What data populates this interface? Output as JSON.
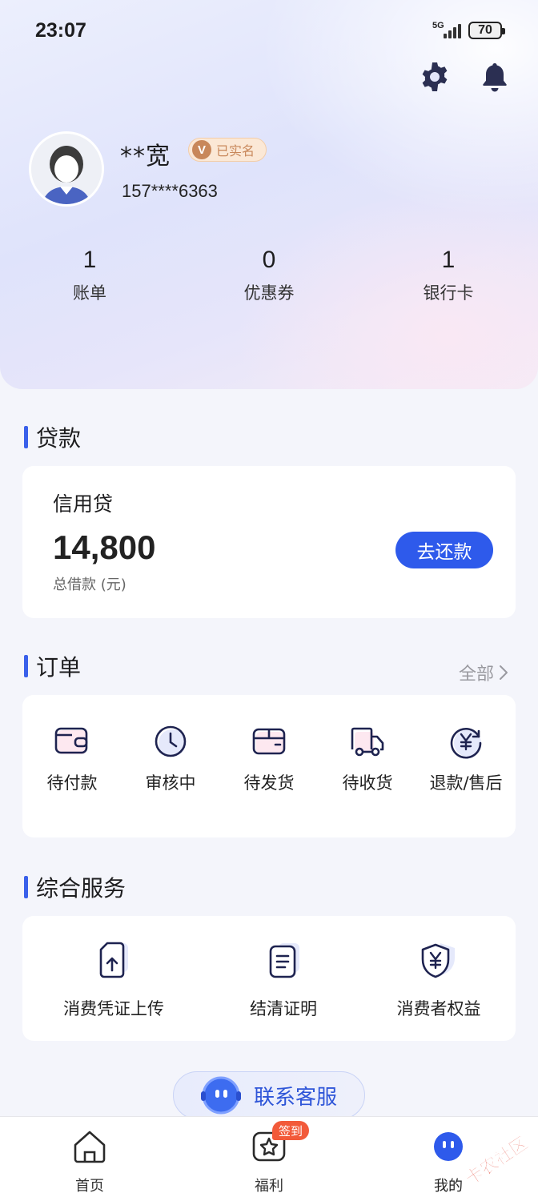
{
  "status_bar": {
    "time": "23:07",
    "network": "5G",
    "battery": "70"
  },
  "profile": {
    "name": "**宽",
    "verified_label": "已实名",
    "verified_badge": "V",
    "phone": "157****6363"
  },
  "stats": [
    {
      "value": "1",
      "label": "账单"
    },
    {
      "value": "0",
      "label": "优惠券"
    },
    {
      "value": "1",
      "label": "银行卡"
    }
  ],
  "loan": {
    "section_title": "贷款",
    "type": "信用贷",
    "amount": "14,800",
    "caption": "总借款 (元)",
    "repay_label": "去还款"
  },
  "orders": {
    "section_title": "订单",
    "see_all": "全部",
    "items": [
      {
        "label": "待付款",
        "icon": "wallet-icon"
      },
      {
        "label": "审核中",
        "icon": "clock-icon"
      },
      {
        "label": "待发货",
        "icon": "package-icon"
      },
      {
        "label": "待收货",
        "icon": "truck-icon"
      },
      {
        "label": "退款/售后",
        "icon": "yuan-refund-icon"
      }
    ]
  },
  "services": {
    "section_title": "综合服务",
    "items": [
      {
        "label": "消费凭证上传",
        "icon": "upload-document-icon"
      },
      {
        "label": "结清证明",
        "icon": "certificate-icon"
      },
      {
        "label": "消费者权益",
        "icon": "shield-yuan-icon"
      }
    ]
  },
  "customer_service": {
    "label": "联系客服"
  },
  "tabbar": {
    "items": [
      {
        "label": "首页",
        "icon": "home-icon"
      },
      {
        "label": "福利",
        "icon": "gift-icon",
        "badge": "签到"
      },
      {
        "label": "我的",
        "icon": "profile-icon"
      }
    ]
  },
  "watermark": {
    "text": "卡农社区"
  },
  "colors": {
    "accent": "#2e5aeb",
    "badge": "#f25a3a",
    "verified": "#c8875a"
  }
}
